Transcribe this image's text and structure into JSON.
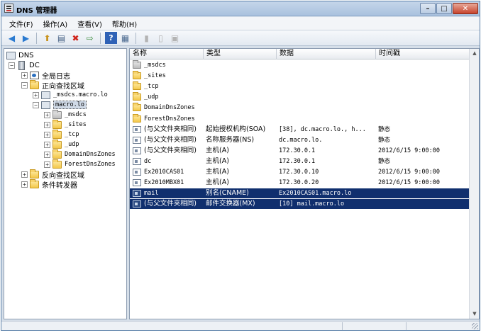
{
  "window": {
    "title": "DNS 管理器"
  },
  "menu": [
    "文件(F)",
    "操作(A)",
    "查看(V)",
    "帮助(H)"
  ],
  "tree": {
    "root": "DNS",
    "server": "DC",
    "global_logs": "全局日志",
    "forward_zones": "正向查找区域",
    "msdcs_zone": "_msdcs.macro.lo",
    "macro_zone": "macro.lo",
    "macro_children": [
      "_msdcs",
      "_sites",
      "_tcp",
      "_udp",
      "DomainDnsZones",
      "ForestDnsZones"
    ],
    "reverse_zones": "反向查找区域",
    "conditional_forwarders": "条件转发器"
  },
  "list": {
    "columns": [
      "名称",
      "类型",
      "数据",
      "时间戳"
    ],
    "rows": [
      {
        "name": "_msdcs",
        "type": "",
        "data": "",
        "ts": "",
        "icon": "folder-gray"
      },
      {
        "name": "_sites",
        "type": "",
        "data": "",
        "ts": "",
        "icon": "folder"
      },
      {
        "name": "_tcp",
        "type": "",
        "data": "",
        "ts": "",
        "icon": "folder"
      },
      {
        "name": "_udp",
        "type": "",
        "data": "",
        "ts": "",
        "icon": "folder"
      },
      {
        "name": "DomainDnsZones",
        "type": "",
        "data": "",
        "ts": "",
        "icon": "folder"
      },
      {
        "name": "ForestDnsZones",
        "type": "",
        "data": "",
        "ts": "",
        "icon": "folder"
      },
      {
        "name": "(与父文件夹相同)",
        "type": "起始授权机构(SOA)",
        "data": "[38], dc.macro.lo., h...",
        "ts": "静态",
        "icon": "record"
      },
      {
        "name": "(与父文件夹相同)",
        "type": "名称服务器(NS)",
        "data": "dc.macro.lo.",
        "ts": "静态",
        "icon": "record"
      },
      {
        "name": "(与父文件夹相同)",
        "type": "主机(A)",
        "data": "172.30.0.1",
        "ts": "2012/6/15 9:00:00",
        "icon": "record"
      },
      {
        "name": "dc",
        "type": "主机(A)",
        "data": "172.30.0.1",
        "ts": "静态",
        "icon": "record"
      },
      {
        "name": "Ex2010CAS01",
        "type": "主机(A)",
        "data": "172.30.0.10",
        "ts": "2012/6/15 9:00:00",
        "icon": "record"
      },
      {
        "name": "Ex2010MBX01",
        "type": "主机(A)",
        "data": "172.30.0.20",
        "ts": "2012/6/15 9:00:00",
        "icon": "record"
      },
      {
        "name": "mail",
        "type": "别名(CNAME)",
        "data": "Ex2010CAS01.macro.lo",
        "ts": "",
        "icon": "record",
        "selected": true
      },
      {
        "name": "(与父文件夹相同)",
        "type": "邮件交换器(MX)",
        "data": "[10]  mail.macro.lo",
        "ts": "",
        "icon": "record",
        "selected": true
      }
    ]
  },
  "colors": {
    "selection": "#102f6e",
    "titlebar": "#b6cae3",
    "folder": "#f4c84b"
  }
}
